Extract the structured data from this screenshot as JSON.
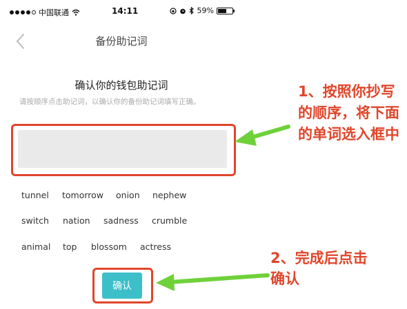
{
  "status_bar": {
    "carrier": "中国联通",
    "time": "14:11",
    "battery": "59%",
    "battery_level": 0.59
  },
  "nav": {
    "title": "备份助记词"
  },
  "main": {
    "heading": "确认你的钱包助记词",
    "hint": "请按顺序点击助记词，以确认你的备份助记词填写正确。",
    "input_value": "",
    "words": [
      "tunnel",
      "tomorrow",
      "onion",
      "nephew",
      "switch",
      "nation",
      "sadness",
      "crumble",
      "animal",
      "top",
      "blossom",
      "actress"
    ],
    "confirm_label": "确认"
  },
  "annotations": {
    "step1": "1、按照你抄写的顺序，将下面的单词选入框中",
    "step2": "2、完成后点击确认"
  },
  "colors": {
    "accent": "#3cbfc9",
    "annotation_red": "#e0452a",
    "arrow_green": "#6fd13a"
  }
}
